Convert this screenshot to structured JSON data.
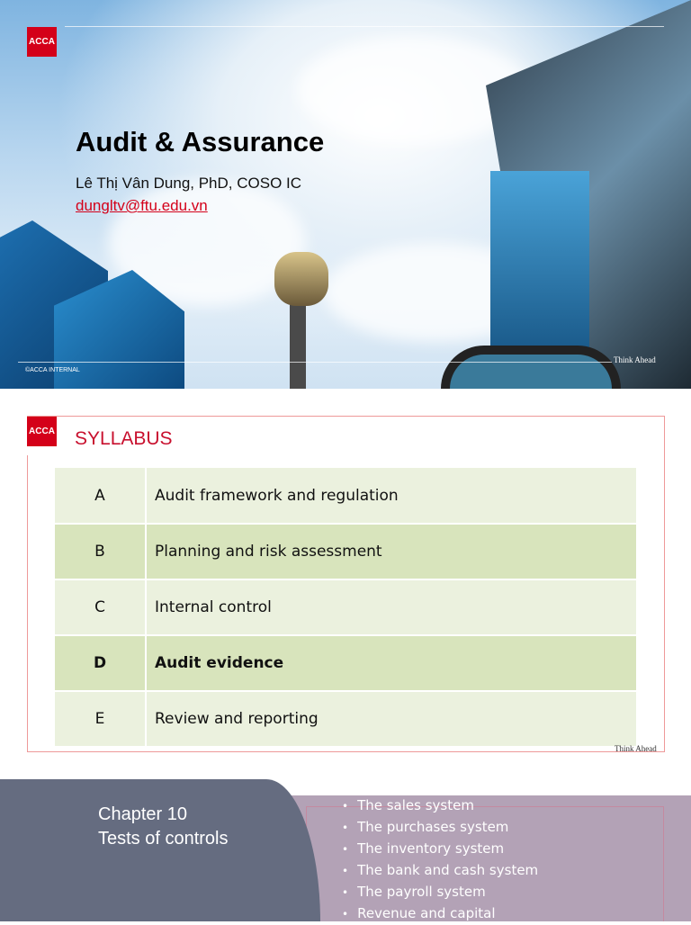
{
  "slide1": {
    "logo": "ACCA",
    "title": "Audit & Assurance",
    "author": "Lê Thị Vân Dung, PhD, COSO IC",
    "email": "dungltv@ftu.edu.vn",
    "footer_left": "©ACCA INTERNAL",
    "footer_right": "Think Ahead"
  },
  "slide2": {
    "logo": "ACCA",
    "title": "SYLLABUS",
    "footer_right": "Think Ahead",
    "rows": [
      {
        "letter": "A",
        "topic": "Audit framework and regulation"
      },
      {
        "letter": "B",
        "topic": "Planning and risk assessment"
      },
      {
        "letter": "C",
        "topic": "Internal control"
      },
      {
        "letter": "D",
        "topic": "Audit evidence"
      },
      {
        "letter": "E",
        "topic": "Review and reporting"
      }
    ]
  },
  "slide3": {
    "chapter": "Chapter 10",
    "subtitle": "Tests of controls",
    "items": [
      "The sales system",
      "The purchases system",
      "The inventory system",
      "The bank and cash system",
      "The payroll system",
      "Revenue and capital"
    ]
  }
}
